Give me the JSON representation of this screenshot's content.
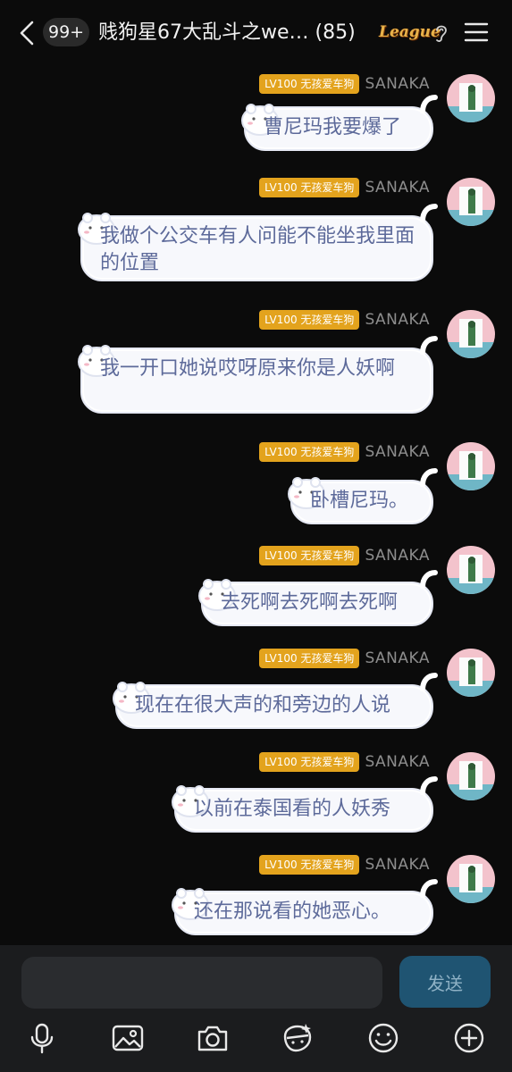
{
  "header": {
    "unread_count": "99+",
    "title": "贱狗星67大乱斗之we…",
    "member_count": "(85)",
    "league_badge": "League"
  },
  "messages": [
    {
      "level": "LV100 无孩爱车狗",
      "sender": "SANAKA",
      "text": "曹尼玛我要爆了"
    },
    {
      "level": "LV100 无孩爱车狗",
      "sender": "SANAKA",
      "text": "我做个公交车有人问能不能坐我里面的位置"
    },
    {
      "level": "LV100 无孩爱车狗",
      "sender": "SANAKA",
      "text": "我一开口她说哎呀原来你是人妖啊"
    },
    {
      "level": "LV100 无孩爱车狗",
      "sender": "SANAKA",
      "text": "卧槽尼玛。"
    },
    {
      "level": "LV100 无孩爱车狗",
      "sender": "SANAKA",
      "text": "去死啊去死啊去死啊"
    },
    {
      "level": "LV100 无孩爱车狗",
      "sender": "SANAKA",
      "text": "现在在很大声的和旁边的人说"
    },
    {
      "level": "LV100 无孩爱车狗",
      "sender": "SANAKA",
      "text": "以前在泰国看的人妖秀"
    },
    {
      "level": "LV100 无孩爱车狗",
      "sender": "SANAKA",
      "text": "还在那说看的她恶心。"
    }
  ],
  "composer": {
    "input_value": "",
    "send_label": "发送"
  },
  "toolbar": {
    "icons": [
      "microphone-icon",
      "image-icon",
      "camera-icon",
      "sticker-icon",
      "emoji-icon",
      "plus-icon"
    ]
  },
  "colors": {
    "bubble_bg": "#f7f8fc",
    "bubble_text": "#5d6a9a",
    "level_tag": "#e3a31d",
    "send_button": "#1f5472",
    "background": "#0b0b0b"
  }
}
